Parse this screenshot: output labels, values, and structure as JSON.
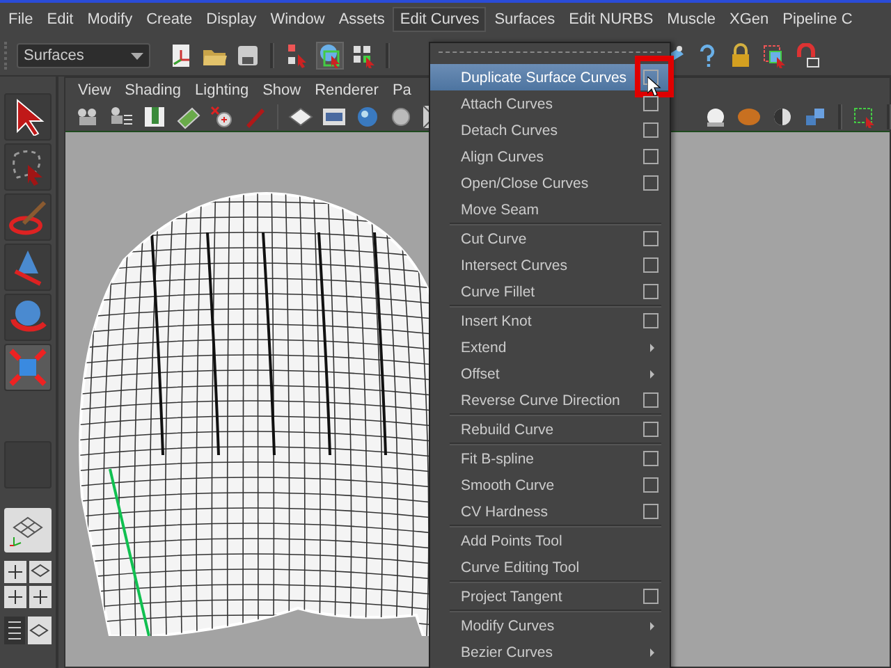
{
  "menubar": {
    "items": [
      {
        "label": "File",
        "selected": false
      },
      {
        "label": "Edit",
        "selected": false
      },
      {
        "label": "Modify",
        "selected": false
      },
      {
        "label": "Create",
        "selected": false
      },
      {
        "label": "Display",
        "selected": false
      },
      {
        "label": "Window",
        "selected": false
      },
      {
        "label": "Assets",
        "selected": false
      },
      {
        "label": "Edit Curves",
        "selected": true
      },
      {
        "label": "Surfaces",
        "selected": false
      },
      {
        "label": "Edit NURBS",
        "selected": false
      },
      {
        "label": "Muscle",
        "selected": false
      },
      {
        "label": "XGen",
        "selected": false
      },
      {
        "label": "Pipeline C",
        "selected": false
      }
    ]
  },
  "toolbar": {
    "menu_set": "Surfaces"
  },
  "panel": {
    "menu": [
      "View",
      "Shading",
      "Lighting",
      "Show",
      "Renderer",
      "Pa"
    ]
  },
  "dropdown": {
    "items": [
      {
        "label": "Duplicate Surface Curves",
        "kind": "option",
        "selected": true,
        "callout": true
      },
      {
        "label": "Attach Curves",
        "kind": "option",
        "selected": false,
        "callout": false
      },
      {
        "label": "Detach Curves",
        "kind": "option",
        "selected": false,
        "callout": false
      },
      {
        "label": "Align Curves",
        "kind": "option",
        "selected": false,
        "callout": false
      },
      {
        "label": "Open/Close Curves",
        "kind": "option",
        "selected": false,
        "callout": false
      },
      {
        "label": "Move Seam",
        "kind": "plain",
        "selected": false,
        "callout": false
      },
      {
        "kind": "separator"
      },
      {
        "label": "Cut Curve",
        "kind": "option",
        "selected": false,
        "callout": false
      },
      {
        "label": "Intersect Curves",
        "kind": "option",
        "selected": false,
        "callout": false
      },
      {
        "label": "Curve Fillet",
        "kind": "option",
        "selected": false,
        "callout": false
      },
      {
        "kind": "separator"
      },
      {
        "label": "Insert Knot",
        "kind": "option",
        "selected": false,
        "callout": false
      },
      {
        "label": "Extend",
        "kind": "submenu",
        "selected": false,
        "callout": false
      },
      {
        "label": "Offset",
        "kind": "submenu",
        "selected": false,
        "callout": false
      },
      {
        "label": "Reverse Curve Direction",
        "kind": "option",
        "selected": false,
        "callout": false
      },
      {
        "kind": "separator"
      },
      {
        "label": "Rebuild Curve",
        "kind": "option",
        "selected": false,
        "callout": false
      },
      {
        "kind": "separator"
      },
      {
        "label": "Fit B-spline",
        "kind": "option",
        "selected": false,
        "callout": false
      },
      {
        "label": "Smooth Curve",
        "kind": "option",
        "selected": false,
        "callout": false
      },
      {
        "label": "CV Hardness",
        "kind": "option",
        "selected": false,
        "callout": false
      },
      {
        "kind": "separator"
      },
      {
        "label": "Add Points Tool",
        "kind": "plain",
        "selected": false,
        "callout": false
      },
      {
        "label": "Curve Editing Tool",
        "kind": "plain",
        "selected": false,
        "callout": false
      },
      {
        "kind": "separator"
      },
      {
        "label": "Project Tangent",
        "kind": "option",
        "selected": false,
        "callout": false
      },
      {
        "kind": "separator"
      },
      {
        "label": "Modify Curves",
        "kind": "submenu",
        "selected": false,
        "callout": false
      },
      {
        "label": "Bezier Curves",
        "kind": "submenu",
        "selected": false,
        "callout": false
      }
    ]
  }
}
